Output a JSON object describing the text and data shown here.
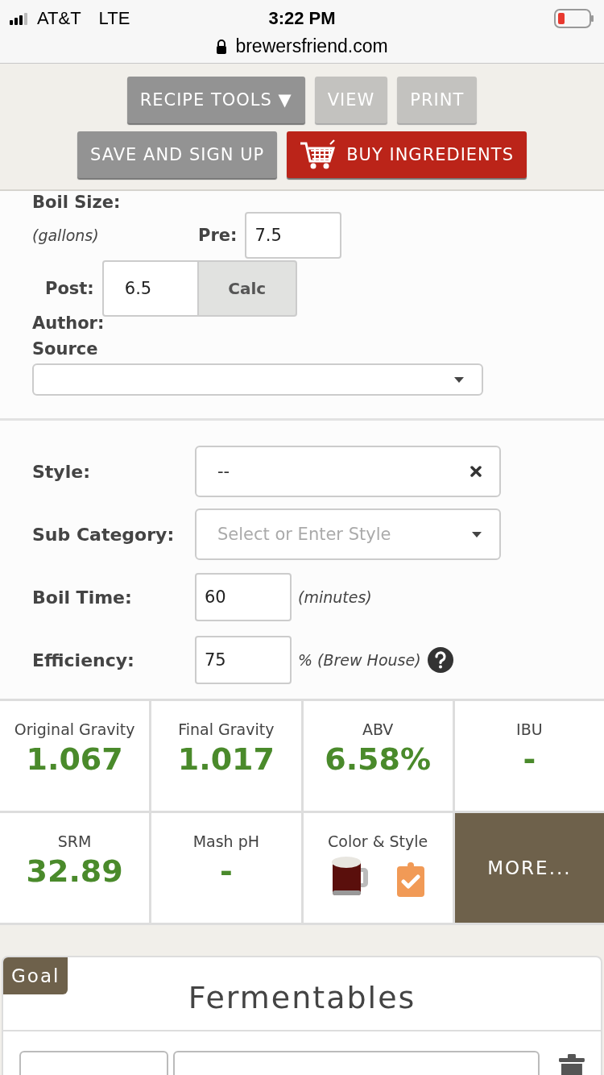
{
  "status_bar": {
    "carrier": "AT&T",
    "network": "LTE",
    "time": "3:22 PM",
    "url": "brewersfriend.com"
  },
  "toolbar": {
    "rows": [
      [
        {
          "label": "RECIPE TOOLS ▼",
          "kind": "menu",
          "disabled": false
        },
        {
          "label": "VIEW",
          "kind": "plain",
          "disabled": true
        },
        {
          "label": "PRINT",
          "kind": "plain",
          "disabled": true
        }
      ],
      [
        {
          "label": "SAVE AND SIGN UP",
          "kind": "plain",
          "disabled": false
        },
        {
          "label": "BUY INGREDIENTS",
          "kind": "cart",
          "disabled": false
        }
      ]
    ]
  },
  "boil_size": {
    "label": "Boil Size:",
    "unit": "(gallons)",
    "pre_label": "Pre:",
    "pre_value": "7.5",
    "post_label": "Post:",
    "post_value": "6.5",
    "calc_button": "Calc"
  },
  "author": {
    "label": "Author:"
  },
  "source": {
    "label": "Source"
  },
  "settings": [
    {
      "kind": "select-clear",
      "label": "Style:",
      "value": "--"
    },
    {
      "kind": "select",
      "label": "Sub Category:",
      "placeholder": "Select or Enter Style"
    },
    {
      "kind": "number",
      "label": "Boil Time:",
      "value": "60",
      "suffix": "(minutes)",
      "help": false
    },
    {
      "kind": "number",
      "label": "Efficiency:",
      "value": "75",
      "suffix": "% (Brew House)",
      "help": true
    }
  ],
  "stats": [
    {
      "kind": "value",
      "label": "Original Gravity",
      "value": "1.067"
    },
    {
      "kind": "value",
      "label": "Final Gravity",
      "value": "1.017"
    },
    {
      "kind": "value",
      "label": "ABV",
      "value": "6.58%"
    },
    {
      "kind": "value",
      "label": "IBU",
      "value": "-"
    },
    {
      "kind": "value",
      "label": "SRM",
      "value": "32.89"
    },
    {
      "kind": "value",
      "label": "Mash pH",
      "value": "-"
    },
    {
      "kind": "icons",
      "label": "Color & Style"
    },
    {
      "kind": "button",
      "label": "MORE..."
    }
  ],
  "fermentables": {
    "badge": "Goal",
    "title": "Fermentables"
  }
}
